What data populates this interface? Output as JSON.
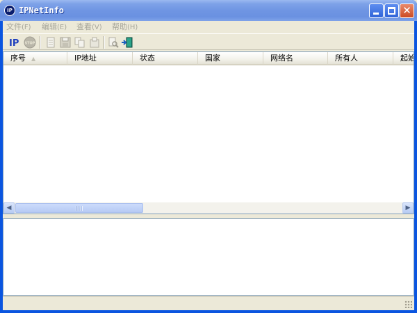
{
  "window": {
    "title": "IPNetInfo",
    "icon_label": "IP",
    "minimize_label": "",
    "maximize_label": "",
    "close_label": "✕"
  },
  "menu": {
    "items": [
      {
        "label": "文件",
        "hotkey": "(F)"
      },
      {
        "label": "编辑",
        "hotkey": "(E)"
      },
      {
        "label": "查看",
        "hotkey": "(V)"
      },
      {
        "label": "帮助",
        "hotkey": "(H)"
      }
    ]
  },
  "toolbar": {
    "ip_label": "IP",
    "stop_label": "STOP"
  },
  "table": {
    "columns": [
      "序号",
      "IP地址",
      "状态",
      "国家",
      "网络名",
      "所有人",
      "起始"
    ],
    "sort_indicator": "▲",
    "rows": []
  },
  "status": {
    "text": ""
  },
  "colors": {
    "title_blue": "#0a55e0",
    "face": "#ece9d8",
    "disabled_text": "#a7a69a"
  }
}
